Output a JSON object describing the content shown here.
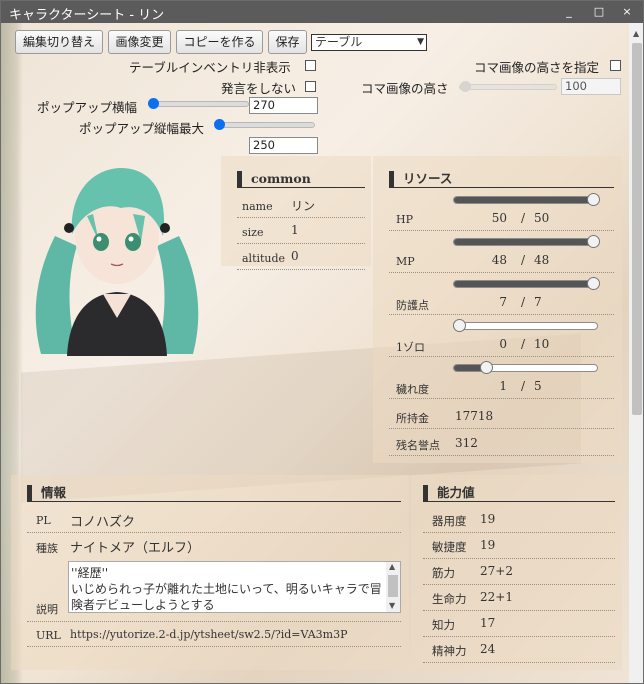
{
  "window": {
    "title": "キャラクターシート - リン",
    "min": "_",
    "max": "□",
    "close": "×"
  },
  "toolbar": {
    "edit_toggle": "編集切り替え",
    "image_change": "画像変更",
    "make_copy": "コピーを作る",
    "save": "保存",
    "layout_select": "テーブル"
  },
  "options": {
    "hide_inventory": "テーブルインベントリ非表示",
    "mute": "発言をしない",
    "specify_height": "コマ画像の高さを指定",
    "piece_height_label": "コマ画像の高さ",
    "piece_height_value": "100",
    "popup_width_label": "ポップアップ横幅",
    "popup_width_value": "270",
    "popup_width_fraction": 0.0,
    "popup_maxh_label": "ポップアップ縦幅最大",
    "popup_maxh_value": "250",
    "popup_maxh_fraction": 0.0
  },
  "common": {
    "heading": "common",
    "rows": [
      {
        "key": "name",
        "value": "リン"
      },
      {
        "key": "size",
        "value": "1"
      },
      {
        "key": "altitude",
        "value": "0"
      }
    ]
  },
  "resources": {
    "heading": "リソース",
    "gauges": [
      {
        "label": "HP",
        "current": "50",
        "sep": "/",
        "max": "50",
        "fraction": 1.0
      },
      {
        "label": "MP",
        "current": "48",
        "sep": "/",
        "max": "48",
        "fraction": 1.0
      },
      {
        "label": "防護点",
        "current": "7",
        "sep": "/",
        "max": "7",
        "fraction": 1.0
      },
      {
        "label": "1ゾロ",
        "current": "0",
        "sep": "/",
        "max": "10",
        "fraction": 0.0
      },
      {
        "label": "穢れ度",
        "current": "1",
        "sep": "/",
        "max": "5",
        "fraction": 0.2
      }
    ],
    "plain": [
      {
        "label": "所持金",
        "value": "17718"
      },
      {
        "label": "残名誉点",
        "value": "312"
      }
    ]
  },
  "info": {
    "heading": "情報",
    "pl_key": "PL",
    "pl_value": "コノハズク",
    "race_key": "種族",
    "race_value": "ナイトメア（エルフ）",
    "desc_key": "説明",
    "desc_lines": [
      "''経歴''",
      "いじめられっ子が離れた土地にいって、明るいキャラで冒",
      "険者デビューしようとする"
    ],
    "url_key": "URL",
    "url_value": "https://yutorize.2-d.jp/ytsheet/sw2.5/?id=VA3m3P"
  },
  "abilities": {
    "heading": "能力値",
    "rows": [
      {
        "key": "器用度",
        "value": "19"
      },
      {
        "key": "敏捷度",
        "value": "19"
      },
      {
        "key": "筋力",
        "value": "27+2"
      },
      {
        "key": "生命力",
        "value": "22+1"
      },
      {
        "key": "知力",
        "value": "17"
      },
      {
        "key": "精神力",
        "value": "24"
      }
    ]
  }
}
